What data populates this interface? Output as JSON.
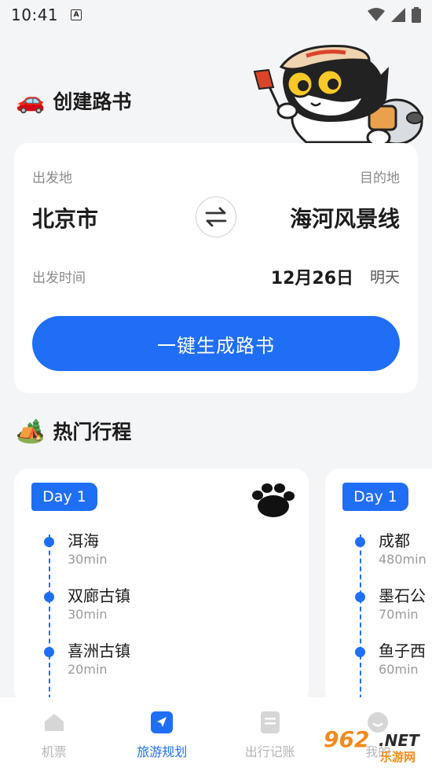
{
  "status": {
    "time": "10:41",
    "notif_letter": "A"
  },
  "roadbook": {
    "emoji": "🚗",
    "title": "创建路书",
    "from_label": "出发地",
    "to_label": "目的地",
    "from_city": "北京市",
    "to_city": "海河风景线",
    "time_label": "出发时间",
    "date": "12月26日",
    "day_word": "明天",
    "generate_button": "一键生成路书"
  },
  "popular": {
    "emoji": "🏕️",
    "title": "热门行程",
    "trips": [
      {
        "day": "Day 1",
        "stops": [
          {
            "name": "洱海",
            "duration": "30min"
          },
          {
            "name": "双廊古镇",
            "duration": "30min"
          },
          {
            "name": "喜洲古镇",
            "duration": "20min"
          }
        ]
      },
      {
        "day": "Day 1",
        "stops": [
          {
            "name": "成都",
            "duration": "480min"
          },
          {
            "name": "墨石公",
            "duration": "70min"
          },
          {
            "name": "鱼子西",
            "duration": "60min"
          }
        ]
      }
    ]
  },
  "tabbar": {
    "items": [
      {
        "label": "机票",
        "icon": "home-icon",
        "active": false
      },
      {
        "label": "旅游规划",
        "icon": "navigation-arrow-icon",
        "active": true
      },
      {
        "label": "出行记账",
        "icon": "document-icon",
        "active": false
      },
      {
        "label": "我的",
        "icon": "profile-icon",
        "active": false
      }
    ]
  },
  "watermark": {
    "text": "962",
    "suffix": ".NET",
    "sub": "乐游网"
  },
  "colors": {
    "accent": "#1f6ef5",
    "background": "#f4f5f7",
    "card": "#ffffff"
  }
}
